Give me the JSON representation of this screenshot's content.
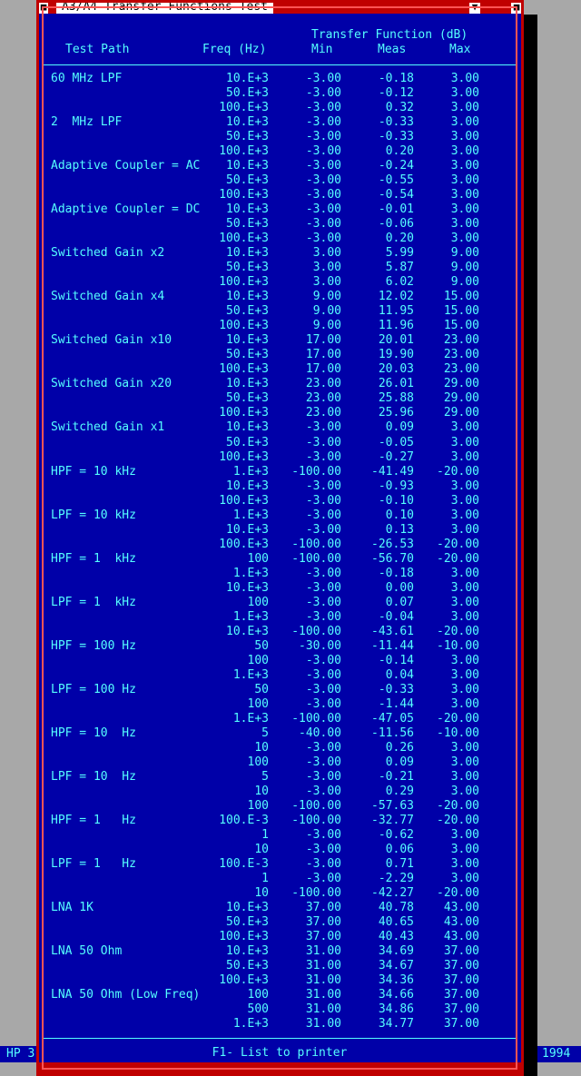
{
  "window": {
    "title": "A3/A4 Transfer Functions Test",
    "close_glyph": "■",
    "scroll_glyph": "▼",
    "resize_glyph": "■"
  },
  "status": {
    "left_text": "HP 3",
    "right_text": "1994"
  },
  "header": {
    "group_label": "Transfer Function (dB)",
    "columns": [
      "Test Path",
      "Freq (Hz)",
      "Min",
      "Meas",
      "Max"
    ]
  },
  "rows": [
    {
      "path": "60 MHz LPF",
      "freq": "10.E+3",
      "min": "-3.00",
      "meas": "-0.18",
      "max": "3.00"
    },
    {
      "path": "",
      "freq": "50.E+3",
      "min": "-3.00",
      "meas": "-0.12",
      "max": "3.00"
    },
    {
      "path": "",
      "freq": "100.E+3",
      "min": "-3.00",
      "meas": "0.32",
      "max": "3.00"
    },
    {
      "path": "2  MHz LPF",
      "freq": "10.E+3",
      "min": "-3.00",
      "meas": "-0.33",
      "max": "3.00"
    },
    {
      "path": "",
      "freq": "50.E+3",
      "min": "-3.00",
      "meas": "-0.33",
      "max": "3.00"
    },
    {
      "path": "",
      "freq": "100.E+3",
      "min": "-3.00",
      "meas": "0.20",
      "max": "3.00"
    },
    {
      "path": "Adaptive Coupler = AC",
      "freq": "10.E+3",
      "min": "-3.00",
      "meas": "-0.24",
      "max": "3.00"
    },
    {
      "path": "",
      "freq": "50.E+3",
      "min": "-3.00",
      "meas": "-0.55",
      "max": "3.00"
    },
    {
      "path": "",
      "freq": "100.E+3",
      "min": "-3.00",
      "meas": "-0.54",
      "max": "3.00"
    },
    {
      "path": "Adaptive Coupler = DC",
      "freq": "10.E+3",
      "min": "-3.00",
      "meas": "-0.01",
      "max": "3.00"
    },
    {
      "path": "",
      "freq": "50.E+3",
      "min": "-3.00",
      "meas": "-0.06",
      "max": "3.00"
    },
    {
      "path": "",
      "freq": "100.E+3",
      "min": "-3.00",
      "meas": "0.20",
      "max": "3.00"
    },
    {
      "path": "Switched Gain x2",
      "freq": "10.E+3",
      "min": "3.00",
      "meas": "5.99",
      "max": "9.00"
    },
    {
      "path": "",
      "freq": "50.E+3",
      "min": "3.00",
      "meas": "5.87",
      "max": "9.00"
    },
    {
      "path": "",
      "freq": "100.E+3",
      "min": "3.00",
      "meas": "6.02",
      "max": "9.00"
    },
    {
      "path": "Switched Gain x4",
      "freq": "10.E+3",
      "min": "9.00",
      "meas": "12.02",
      "max": "15.00"
    },
    {
      "path": "",
      "freq": "50.E+3",
      "min": "9.00",
      "meas": "11.95",
      "max": "15.00"
    },
    {
      "path": "",
      "freq": "100.E+3",
      "min": "9.00",
      "meas": "11.96",
      "max": "15.00"
    },
    {
      "path": "Switched Gain x10",
      "freq": "10.E+3",
      "min": "17.00",
      "meas": "20.01",
      "max": "23.00"
    },
    {
      "path": "",
      "freq": "50.E+3",
      "min": "17.00",
      "meas": "19.90",
      "max": "23.00"
    },
    {
      "path": "",
      "freq": "100.E+3",
      "min": "17.00",
      "meas": "20.03",
      "max": "23.00"
    },
    {
      "path": "Switched Gain x20",
      "freq": "10.E+3",
      "min": "23.00",
      "meas": "26.01",
      "max": "29.00"
    },
    {
      "path": "",
      "freq": "50.E+3",
      "min": "23.00",
      "meas": "25.88",
      "max": "29.00"
    },
    {
      "path": "",
      "freq": "100.E+3",
      "min": "23.00",
      "meas": "25.96",
      "max": "29.00"
    },
    {
      "path": "Switched Gain x1",
      "freq": "10.E+3",
      "min": "-3.00",
      "meas": "0.09",
      "max": "3.00"
    },
    {
      "path": "",
      "freq": "50.E+3",
      "min": "-3.00",
      "meas": "-0.05",
      "max": "3.00"
    },
    {
      "path": "",
      "freq": "100.E+3",
      "min": "-3.00",
      "meas": "-0.27",
      "max": "3.00"
    },
    {
      "path": "HPF = 10 kHz",
      "freq": "1.E+3",
      "min": "-100.00",
      "meas": "-41.49",
      "max": "-20.00"
    },
    {
      "path": "",
      "freq": "10.E+3",
      "min": "-3.00",
      "meas": "-0.93",
      "max": "3.00"
    },
    {
      "path": "",
      "freq": "100.E+3",
      "min": "-3.00",
      "meas": "-0.10",
      "max": "3.00"
    },
    {
      "path": "LPF = 10 kHz",
      "freq": "1.E+3",
      "min": "-3.00",
      "meas": "0.10",
      "max": "3.00"
    },
    {
      "path": "",
      "freq": "10.E+3",
      "min": "-3.00",
      "meas": "0.13",
      "max": "3.00"
    },
    {
      "path": "",
      "freq": "100.E+3",
      "min": "-100.00",
      "meas": "-26.53",
      "max": "-20.00"
    },
    {
      "path": "HPF = 1  kHz",
      "freq": "100",
      "min": "-100.00",
      "meas": "-56.70",
      "max": "-20.00"
    },
    {
      "path": "",
      "freq": "1.E+3",
      "min": "-3.00",
      "meas": "-0.18",
      "max": "3.00"
    },
    {
      "path": "",
      "freq": "10.E+3",
      "min": "-3.00",
      "meas": "0.00",
      "max": "3.00"
    },
    {
      "path": "LPF = 1  kHz",
      "freq": "100",
      "min": "-3.00",
      "meas": "0.07",
      "max": "3.00"
    },
    {
      "path": "",
      "freq": "1.E+3",
      "min": "-3.00",
      "meas": "-0.04",
      "max": "3.00"
    },
    {
      "path": "",
      "freq": "10.E+3",
      "min": "-100.00",
      "meas": "-43.61",
      "max": "-20.00"
    },
    {
      "path": "HPF = 100 Hz",
      "freq": "50",
      "min": "-30.00",
      "meas": "-11.44",
      "max": "-10.00"
    },
    {
      "path": "",
      "freq": "100",
      "min": "-3.00",
      "meas": "-0.14",
      "max": "3.00"
    },
    {
      "path": "",
      "freq": "1.E+3",
      "min": "-3.00",
      "meas": "0.04",
      "max": "3.00"
    },
    {
      "path": "LPF = 100 Hz",
      "freq": "50",
      "min": "-3.00",
      "meas": "-0.33",
      "max": "3.00"
    },
    {
      "path": "",
      "freq": "100",
      "min": "-3.00",
      "meas": "-1.44",
      "max": "3.00"
    },
    {
      "path": "",
      "freq": "1.E+3",
      "min": "-100.00",
      "meas": "-47.05",
      "max": "-20.00"
    },
    {
      "path": "HPF = 10  Hz",
      "freq": "5",
      "min": "-40.00",
      "meas": "-11.56",
      "max": "-10.00"
    },
    {
      "path": "",
      "freq": "10",
      "min": "-3.00",
      "meas": "0.26",
      "max": "3.00"
    },
    {
      "path": "",
      "freq": "100",
      "min": "-3.00",
      "meas": "0.09",
      "max": "3.00"
    },
    {
      "path": "LPF = 10  Hz",
      "freq": "5",
      "min": "-3.00",
      "meas": "-0.21",
      "max": "3.00"
    },
    {
      "path": "",
      "freq": "10",
      "min": "-3.00",
      "meas": "0.29",
      "max": "3.00"
    },
    {
      "path": "",
      "freq": "100",
      "min": "-100.00",
      "meas": "-57.63",
      "max": "-20.00"
    },
    {
      "path": "HPF = 1   Hz",
      "freq": "100.E-3",
      "min": "-100.00",
      "meas": "-32.77",
      "max": "-20.00"
    },
    {
      "path": "",
      "freq": "1",
      "min": "-3.00",
      "meas": "-0.62",
      "max": "3.00"
    },
    {
      "path": "",
      "freq": "10",
      "min": "-3.00",
      "meas": "0.06",
      "max": "3.00"
    },
    {
      "path": "LPF = 1   Hz",
      "freq": "100.E-3",
      "min": "-3.00",
      "meas": "0.71",
      "max": "3.00"
    },
    {
      "path": "",
      "freq": "1",
      "min": "-3.00",
      "meas": "-2.29",
      "max": "3.00"
    },
    {
      "path": "",
      "freq": "10",
      "min": "-100.00",
      "meas": "-42.27",
      "max": "-20.00"
    },
    {
      "path": "LNA 1K",
      "freq": "10.E+3",
      "min": "37.00",
      "meas": "40.78",
      "max": "43.00"
    },
    {
      "path": "",
      "freq": "50.E+3",
      "min": "37.00",
      "meas": "40.65",
      "max": "43.00"
    },
    {
      "path": "",
      "freq": "100.E+3",
      "min": "37.00",
      "meas": "40.43",
      "max": "43.00"
    },
    {
      "path": "LNA 50 Ohm",
      "freq": "10.E+3",
      "min": "31.00",
      "meas": "34.69",
      "max": "37.00"
    },
    {
      "path": "",
      "freq": "50.E+3",
      "min": "31.00",
      "meas": "34.67",
      "max": "37.00"
    },
    {
      "path": "",
      "freq": "100.E+3",
      "min": "31.00",
      "meas": "34.36",
      "max": "37.00"
    },
    {
      "path": "LNA 50 Ohm (Low Freq)",
      "freq": "100",
      "min": "31.00",
      "meas": "34.66",
      "max": "37.00"
    },
    {
      "path": "",
      "freq": "500",
      "min": "31.00",
      "meas": "34.86",
      "max": "37.00"
    },
    {
      "path": "",
      "freq": "1.E+3",
      "min": "31.00",
      "meas": "34.77",
      "max": "37.00"
    }
  ],
  "footer": {
    "hint": "F1- List to printer"
  }
}
